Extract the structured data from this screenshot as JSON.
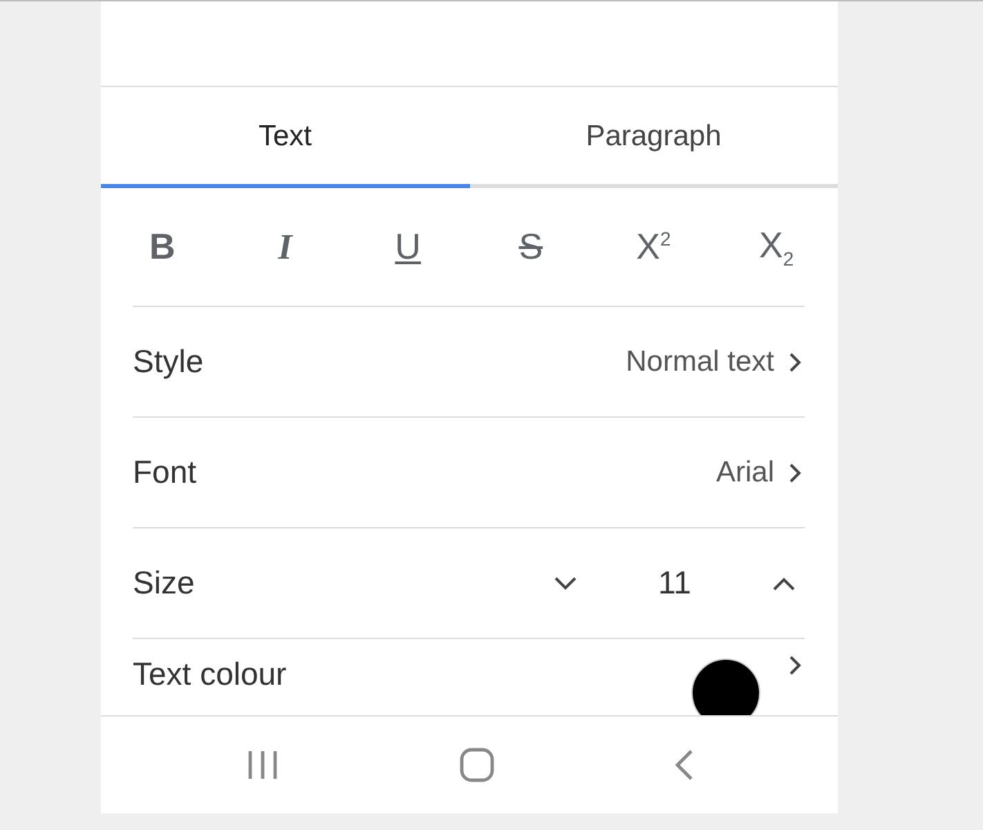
{
  "tabs": [
    {
      "label": "Text",
      "selected": true
    },
    {
      "label": "Paragraph",
      "selected": false
    }
  ],
  "format_buttons": [
    {
      "kind": "bold",
      "label": "B"
    },
    {
      "kind": "italic",
      "label": "I"
    },
    {
      "kind": "underline",
      "label": "U"
    },
    {
      "kind": "strike",
      "label": "S"
    },
    {
      "kind": "superscript",
      "label": "X$^{2}$"
    },
    {
      "kind": "subscript",
      "label": "X$_{2}$"
    }
  ],
  "rows": [
    {
      "kind": "link",
      "label": "Style",
      "value": "Normal text"
    },
    {
      "kind": "link",
      "label": "Font",
      "value": "Arial"
    },
    {
      "kind": "stepper",
      "label": "Size",
      "value": "11"
    },
    {
      "kind": "color",
      "label": "Text colour",
      "color": "#000000"
    }
  ]
}
